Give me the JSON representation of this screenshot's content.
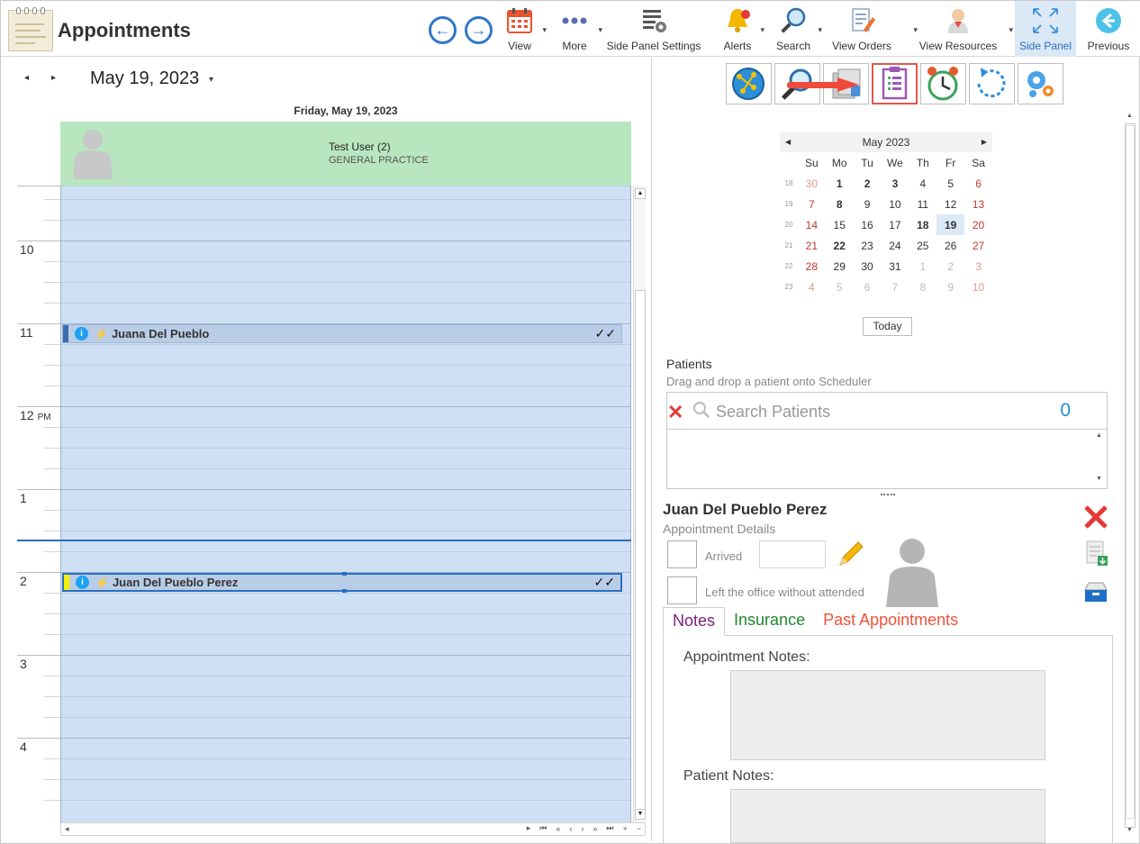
{
  "app": {
    "title": "Appointments"
  },
  "toolbar": {
    "items": [
      {
        "label": "View",
        "icon": "calendar-icon"
      },
      {
        "label": "More",
        "icon": "more-icon"
      },
      {
        "label": "Side Panel Settings",
        "icon": "panel-settings-icon"
      },
      {
        "label": "Alerts",
        "icon": "bell-icon"
      },
      {
        "label": "Search",
        "icon": "search-icon"
      },
      {
        "label": "View Orders",
        "icon": "orders-icon"
      },
      {
        "label": "View Resources",
        "icon": "resources-icon"
      },
      {
        "label": "Side Panel",
        "icon": "expand-icon"
      },
      {
        "label": "Previous",
        "icon": "previous-icon"
      }
    ]
  },
  "scheduler": {
    "date": "May 19, 2023",
    "day_header": "Friday, May 19, 2023",
    "resource": {
      "name": "Test User (2)",
      "department": "GENERAL PRACTICE"
    },
    "hours": [
      {
        "label": "10",
        "suffix": ""
      },
      {
        "label": "11",
        "suffix": ""
      },
      {
        "label": "12",
        "suffix": "PM"
      },
      {
        "label": "1",
        "suffix": ""
      },
      {
        "label": "2",
        "suffix": ""
      },
      {
        "label": "3",
        "suffix": ""
      },
      {
        "label": "4",
        "suffix": ""
      }
    ],
    "appointments": [
      {
        "patient": "Juana Del Pueblo",
        "status": "✓✓",
        "selected": false
      },
      {
        "patient": "Juan Del Pueblo Perez",
        "status": "✓✓",
        "selected": true
      }
    ]
  },
  "side_panel": {
    "calendar": {
      "month_label": "May 2023",
      "weekdays": [
        "Su",
        "Mo",
        "Tu",
        "We",
        "Th",
        "Fr",
        "Sa"
      ],
      "weeks": [
        {
          "wk": "18",
          "days": [
            "30",
            "1",
            "2",
            "3",
            "4",
            "5",
            "6"
          ]
        },
        {
          "wk": "19",
          "days": [
            "7",
            "8",
            "9",
            "10",
            "11",
            "12",
            "13"
          ]
        },
        {
          "wk": "20",
          "days": [
            "14",
            "15",
            "16",
            "17",
            "18",
            "19",
            "20"
          ]
        },
        {
          "wk": "21",
          "days": [
            "21",
            "22",
            "23",
            "24",
            "25",
            "26",
            "27"
          ]
        },
        {
          "wk": "22",
          "days": [
            "28",
            "29",
            "30",
            "31",
            "1",
            "2",
            "3"
          ]
        },
        {
          "wk": "23",
          "days": [
            "4",
            "5",
            "6",
            "7",
            "8",
            "9",
            "10"
          ]
        }
      ],
      "selected_day": "19",
      "today_label": "Today"
    },
    "patients": {
      "title": "Patients",
      "subtitle": "Drag and drop a patient onto Scheduler",
      "search_placeholder": "Search Patients",
      "count": "0"
    },
    "details": {
      "patient_name": "Juan Del Pueblo Perez",
      "subtitle": "Appointment Details",
      "arrived_label": "Arrived",
      "left_label": "Left the office without attended"
    },
    "tabs": [
      {
        "label": "Notes",
        "active": true
      },
      {
        "label": "Insurance",
        "active": false
      },
      {
        "label": "Past Appointments",
        "active": false
      }
    ],
    "notes": {
      "appointment_label": "Appointment Notes:",
      "patient_label": "Patient Notes:"
    }
  },
  "colors": {
    "accent": "#2a6fbf",
    "resource_header": "#b8e6bf",
    "schedule_bg": "#cfe0f4",
    "highlight_border": "#e0584a"
  }
}
